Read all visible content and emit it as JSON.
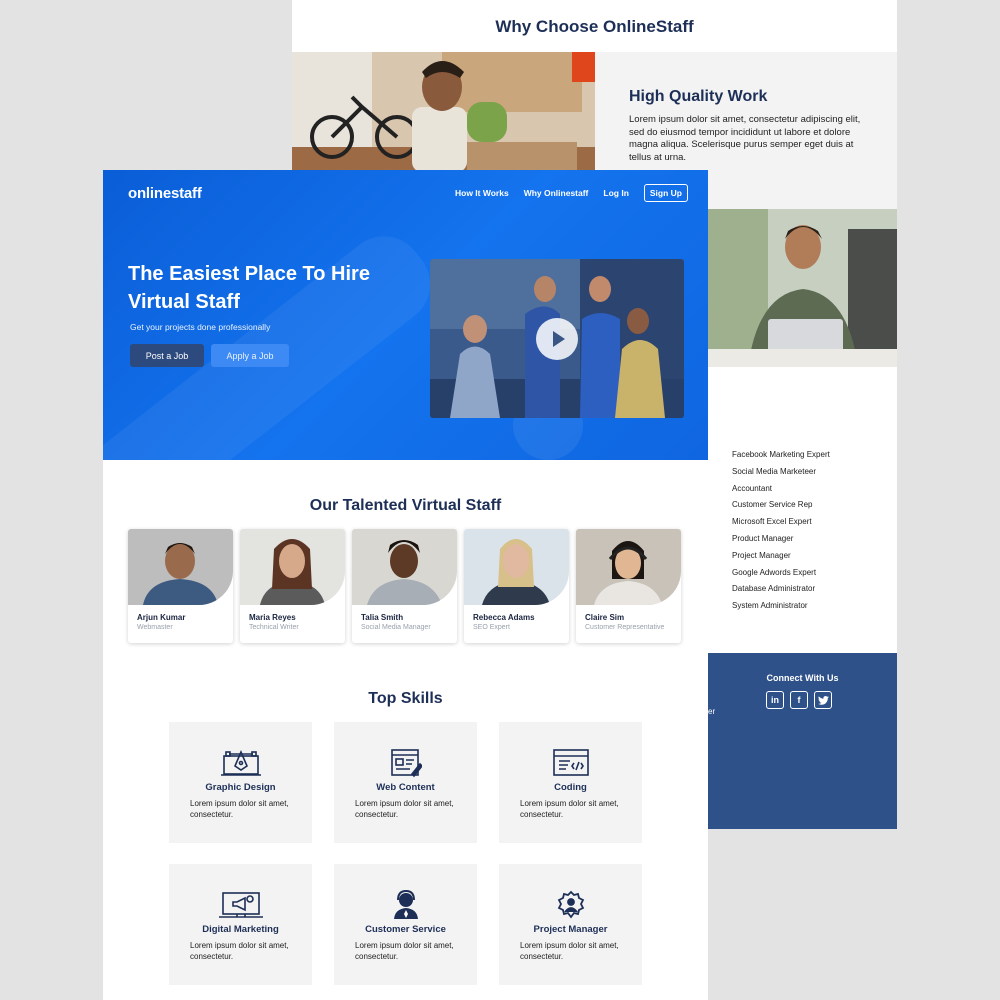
{
  "back_page": {
    "heading": "Why Choose OnlineStaff",
    "high_quality": {
      "title": "High Quality Work",
      "text": "Lorem ipsum dolor sit amet, consectetur adipiscing elit, sed do eiusmod tempor incididunt ut labore et dolore magna aliqua. Scelerisque purus semper eget duis at tellus at urna."
    },
    "job_titles": [
      "Facebook Marketing Expert",
      "Social Media Marketeer",
      "Accountant",
      "Customer Service Rep",
      "Microsoft Excel Expert",
      "Product Manager",
      "Project Manager",
      "Google Adwords  Expert",
      "Database Administrator",
      "System Administrator"
    ],
    "footer": {
      "connect_title": "Connect With Us",
      "social": [
        {
          "icon": "linkedin-icon",
          "glyph": "in"
        },
        {
          "icon": "facebook-icon",
          "glyph": "f"
        },
        {
          "icon": "twitter-icon",
          "glyph": "t"
        }
      ],
      "cropped_text": "er"
    }
  },
  "front_page": {
    "logo": "onlinestaff",
    "nav": [
      "How It Works",
      "Why Onlinestaff",
      "Log In",
      "Sign Up"
    ],
    "hero": {
      "title": "The Easiest Place To Hire Virtual Staff",
      "subtitle": "Get your projects done professionally",
      "post_job": "Post a Job",
      "apply_job": "Apply a Job"
    },
    "staff_section": {
      "title": "Our Talented Virtual Staff",
      "staff": [
        {
          "name": "Arjun Kumar",
          "role": "Webmaster"
        },
        {
          "name": "Maria Reyes",
          "role": "Technical Writer"
        },
        {
          "name": "Talia Smith",
          "role": "Social Media Manager"
        },
        {
          "name": "Rebecca Adams",
          "role": "SEO Expert"
        },
        {
          "name": "Claire Sim",
          "role": "Customer Representative"
        }
      ]
    },
    "skills_section": {
      "title": "Top Skills",
      "skills": [
        {
          "name": "Graphic Design",
          "desc": "Lorem ipsum dolor sit amet, consectetur.",
          "icon": "graphic-design-icon"
        },
        {
          "name": "Web Content",
          "desc": "Lorem ipsum dolor sit amet, consectetur.",
          "icon": "web-content-icon"
        },
        {
          "name": "Coding",
          "desc": "Lorem ipsum dolor sit amet, consectetur.",
          "icon": "coding-icon"
        },
        {
          "name": "Digital Marketing",
          "desc": "Lorem ipsum dolor sit amet, consectetur.",
          "icon": "digital-marketing-icon"
        },
        {
          "name": "Customer Service",
          "desc": "Lorem ipsum dolor sit amet, consectetur.",
          "icon": "customer-service-icon"
        },
        {
          "name": "Project Manager",
          "desc": "Lorem ipsum dolor sit amet, consectetur.",
          "icon": "project-manager-icon"
        }
      ]
    }
  },
  "colors": {
    "hero_blue": "#0f66e0",
    "navy": "#1d2f57",
    "footer_blue": "#2f5189",
    "card_grey": "#f3f3f3"
  }
}
